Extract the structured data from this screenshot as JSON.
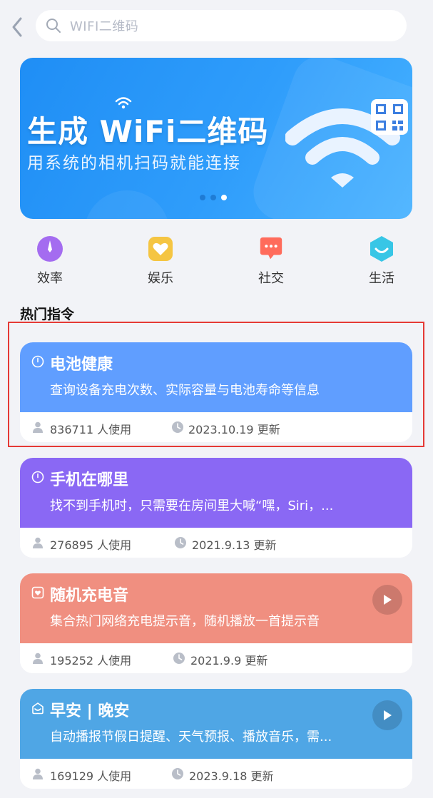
{
  "search": {
    "placeholder": "WIFI二维码"
  },
  "banner": {
    "title": "生成 WiFi二维码",
    "subtitle": "用系统的相机扫码就能连接",
    "active_dot": 3,
    "dots": 3
  },
  "categories": [
    {
      "label": "效率",
      "icon": "compass-icon",
      "color": "#a46cf0"
    },
    {
      "label": "娱乐",
      "icon": "heart-icon",
      "color": "#f5c542"
    },
    {
      "label": "社交",
      "icon": "chat-icon",
      "color": "#ff6b5b"
    },
    {
      "label": "生活",
      "icon": "smile-icon",
      "color": "#38c6e6"
    }
  ],
  "section_title": "热门指令",
  "cards": [
    {
      "title": "电池健康",
      "desc": "查询设备充电次数、实际容量与电池寿命等信息",
      "users": "836711 人使用",
      "updated": "2023.10.19 更新",
      "color": "#609eff",
      "icon": "clock-icon",
      "has_play": false
    },
    {
      "title": "手机在哪里",
      "desc": "找不到手机时，只需要在房间里大喊“嘿，Siri，...",
      "users": "276895 人使用",
      "updated": "2021.9.13 更新",
      "color": "#8a68f4",
      "icon": "clock-icon",
      "has_play": false
    },
    {
      "title": "随机充电音",
      "desc": "集合热门网络充电提示音，随机播放一首提示音",
      "users": "195252 人使用",
      "updated": "2021.9.9 更新",
      "color": "#f08f80",
      "icon": "heart-box-icon",
      "has_play": true
    },
    {
      "title": "早安 | 晚安",
      "desc": "自动播报节假日提醒、天气预报、播放音乐，需...",
      "users": "169129 人使用",
      "updated": "2023.9.18 更新",
      "color": "#4fa6e5",
      "icon": "inbox-icon",
      "has_play": true
    }
  ]
}
